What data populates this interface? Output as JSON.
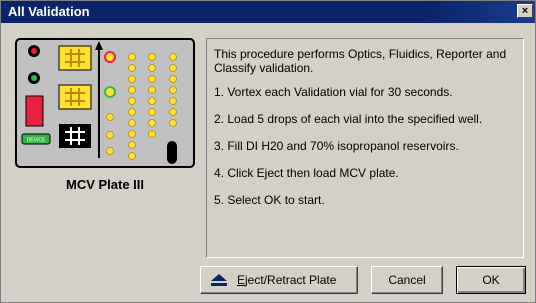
{
  "window": {
    "title": "All Validation",
    "close_label": "×"
  },
  "plate": {
    "label": "MCV Plate III",
    "chip_text": "DEVICE"
  },
  "instructions": {
    "intro": "This procedure performs Optics, Fluidics, Reporter and Classify validation.",
    "steps": [
      "1. Vortex each Validation vial for 30 seconds.",
      "2. Load 5 drops of each vial into the specified well.",
      "3. Fill DI H20 and 70% isopropanol reservoirs.",
      "4. Click Eject then load MCV plate.",
      "5. Select OK to start."
    ]
  },
  "buttons": {
    "eject_mnemonic": "E",
    "eject_rest": "ject/Retract Plate",
    "cancel": "Cancel",
    "ok": "OK"
  },
  "colors": {
    "titlebar": "#0a246a",
    "plate_body": "#c0c0c0",
    "plate_yellow": "#ffe033",
    "plate_red": "#e8213f",
    "plate_green": "#3ab34a"
  }
}
